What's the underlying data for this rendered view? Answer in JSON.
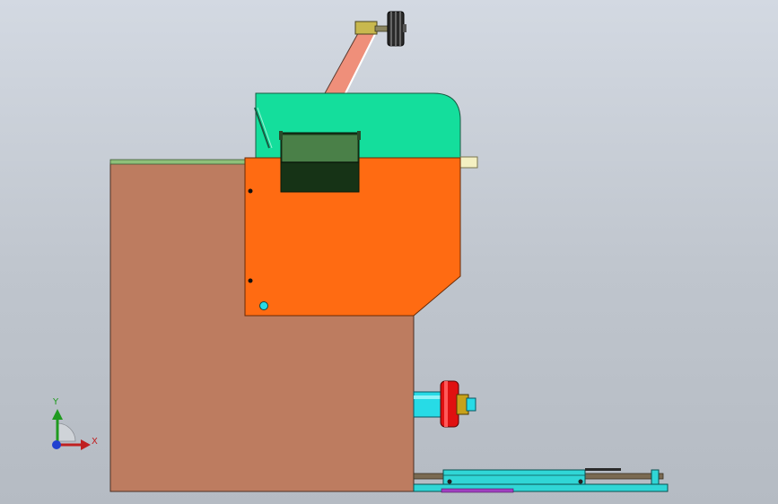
{
  "viewport": {
    "type": "cad-3d-view",
    "background_top": "#d3d9e2",
    "background_bottom": "#b5bbc3"
  },
  "triad": {
    "x_label": "X",
    "y_label": "Y",
    "x_color": "#c02020",
    "y_color": "#1f9a1f",
    "z_color": "#2040d0"
  },
  "model": {
    "parts": [
      {
        "name": "base-cabinet",
        "color": "#bd7c60"
      },
      {
        "name": "top-plate",
        "color": "#8ec07a"
      },
      {
        "name": "orange-housing",
        "color": "#ff6b12"
      },
      {
        "name": "green-upper-cover",
        "color": "#14de9c"
      },
      {
        "name": "drawer-box",
        "color": "#3e7a3e"
      },
      {
        "name": "motor-arm",
        "color": "#ef8f7a"
      },
      {
        "name": "pulley",
        "color": "#1e1e1e"
      },
      {
        "name": "red-flange",
        "color": "#e01010"
      },
      {
        "name": "cyan-shaft",
        "color": "#27dbe6"
      },
      {
        "name": "bottom-rail",
        "color": "#30d6d6"
      }
    ]
  }
}
